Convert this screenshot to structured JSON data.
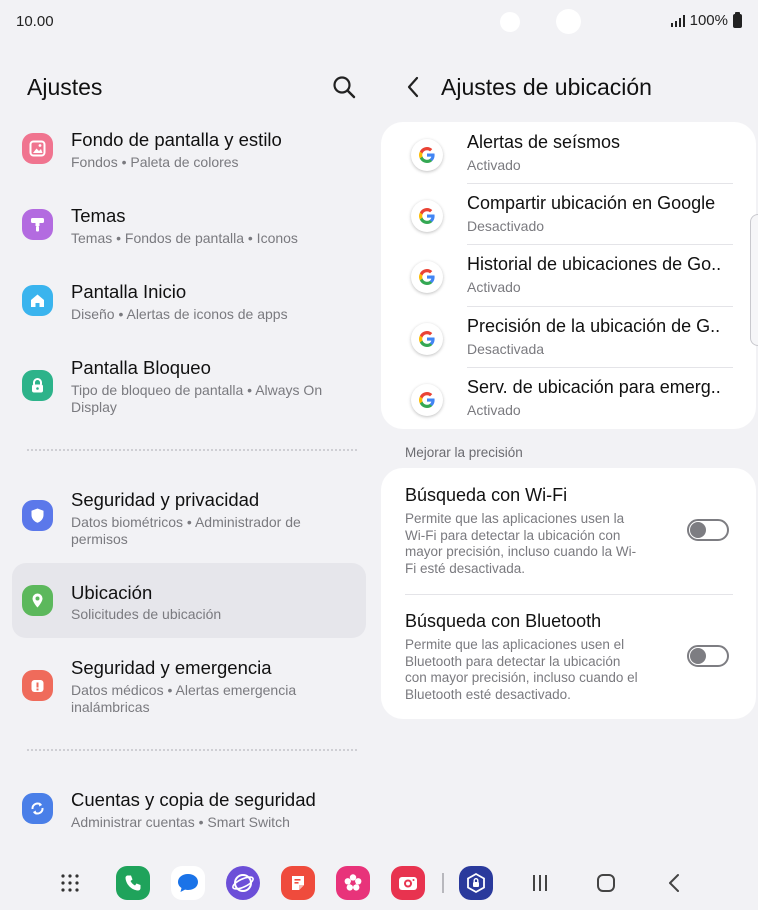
{
  "status_bar": {
    "time": "10.00",
    "battery": "100%"
  },
  "left_pane": {
    "title": "Ajustes",
    "items": [
      {
        "title": "Fondo de pantalla y estilo",
        "subtitle": "Fondos  •  Paleta de colores",
        "icon": "wallpaper-icon",
        "color": "#f0748f"
      },
      {
        "title": "Temas",
        "subtitle": "Temas  •  Fondos de pantalla  •  Iconos",
        "icon": "themes-icon",
        "color": "#b36be0"
      },
      {
        "title": "Pantalla Inicio",
        "subtitle": "Diseño  •  Alertas de iconos de apps",
        "icon": "home-icon",
        "color": "#3ab4ee"
      },
      {
        "title": "Pantalla Bloqueo",
        "subtitle": "Tipo de bloqueo de pantalla  •  Always On Display",
        "icon": "lock-icon",
        "color": "#2db38a"
      },
      {
        "title": "Seguridad y privacidad",
        "subtitle": "Datos biométricos  •  Administrador de permisos",
        "icon": "shield-icon",
        "color": "#5b78ea"
      },
      {
        "title": "Ubicación",
        "subtitle": "Solicitudes de ubicación",
        "icon": "location-pin-icon",
        "color": "#5cb85c"
      },
      {
        "title": "Seguridad y emergencia",
        "subtitle": "Datos médicos  •  Alertas emergencia inalámbricas",
        "icon": "emergency-icon",
        "color": "#ef6b5b"
      },
      {
        "title": "Cuentas y copia de seguridad",
        "subtitle": "Administrar cuentas  •  Smart Switch",
        "icon": "sync-icon",
        "color": "#4a7fe8"
      }
    ]
  },
  "right_pane": {
    "title": "Ajustes de ubicación",
    "services": [
      {
        "title": "Alertas de seísmos",
        "status": "Activado"
      },
      {
        "title": "Compartir ubicación en Google",
        "status": "Desactivado"
      },
      {
        "title": "Historial de ubicaciones de Go..",
        "status": "Activado"
      },
      {
        "title": "Precisión de la ubicación de G..",
        "status": "Desactivada"
      },
      {
        "title": "Serv. de ubicación para emerg..",
        "status": "Activado"
      }
    ],
    "section_label": "Mejorar la precisión",
    "toggles": [
      {
        "title": "Búsqueda con Wi-Fi",
        "description": "Permite que las aplicaciones usen la Wi-Fi para detectar la ubicación con mayor precisión, incluso cuando la Wi-Fi esté desactivada.",
        "on": false
      },
      {
        "title": "Búsqueda con Bluetooth",
        "description": "Permite que las aplicaciones usen el Bluetooth para detectar la ubicación con mayor precisión, incluso cuando el Bluetooth esté desactivado.",
        "on": false
      }
    ]
  },
  "dock": {
    "apps": [
      {
        "name": "phone-app-icon",
        "color": "#1fa35b"
      },
      {
        "name": "messages-app-icon",
        "color": "#ffffff"
      },
      {
        "name": "internet-app-icon",
        "color": "#6c4fd8"
      },
      {
        "name": "notes-app-icon",
        "color": "#ef4b3c"
      },
      {
        "name": "gallery-app-icon",
        "color": "#e8337a"
      },
      {
        "name": "camera-app-icon",
        "color": "#e8334f"
      },
      {
        "name": "secure-folder-app-icon",
        "color": "#2a3a9c"
      }
    ]
  },
  "colors": {
    "background": "#f2f2f5",
    "card": "#ffffff",
    "selected_item": "#e6e6eb",
    "secondary_text": "#7a7a7f"
  }
}
